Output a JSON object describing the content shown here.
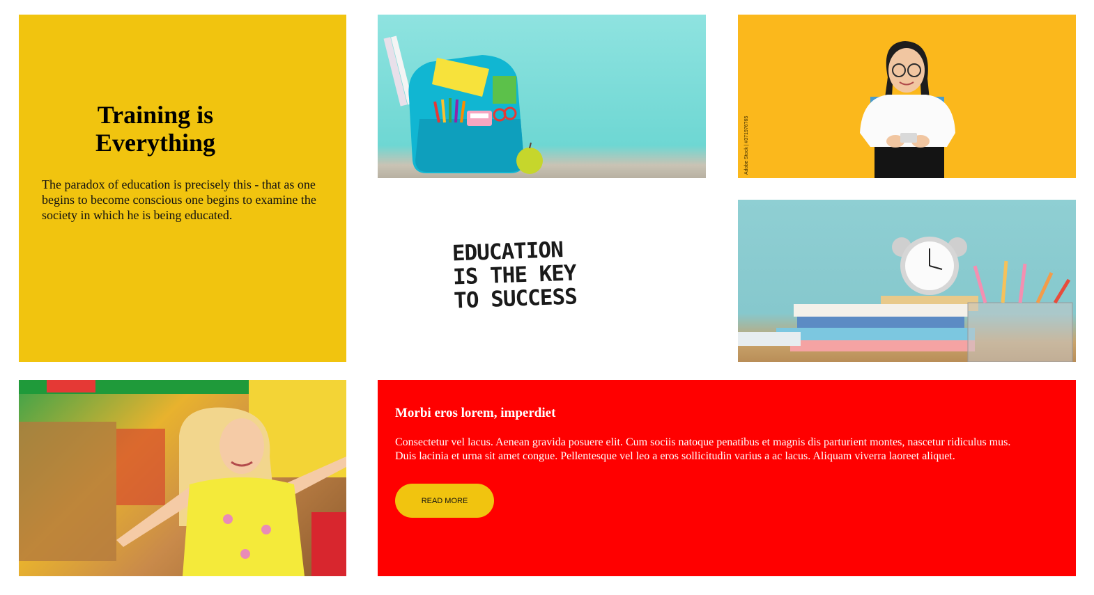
{
  "intro": {
    "title_line1": "Training is",
    "title_line2": "Everything",
    "body": "The paradox of education is precisely this - that as one begins to become conscious one begins to examine the society in which he is being educated."
  },
  "quote": {
    "line1": "EDUCATION",
    "line2": "IS THE KEY",
    "line3": "TO SUCCESS"
  },
  "cta": {
    "heading": "Morbi eros lorem, imperdiet",
    "body": "Consectetur vel lacus. Aenean gravida posuere elit. Cum sociis natoque penatibus et magnis dis parturient montes, nascetur ridiculus mus. Duis lacinia et urna sit amet congue. Pellentesque vel leo a eros sollicitudin varius a ac lacus. Aliquam viverra laoreet aliquet.",
    "button_label": "READ MORE"
  },
  "colors": {
    "yellow": "#f1c40f",
    "red": "#ff0000",
    "photo_orange": "#fbb81c",
    "photo_teal": "#8fe3e0"
  }
}
